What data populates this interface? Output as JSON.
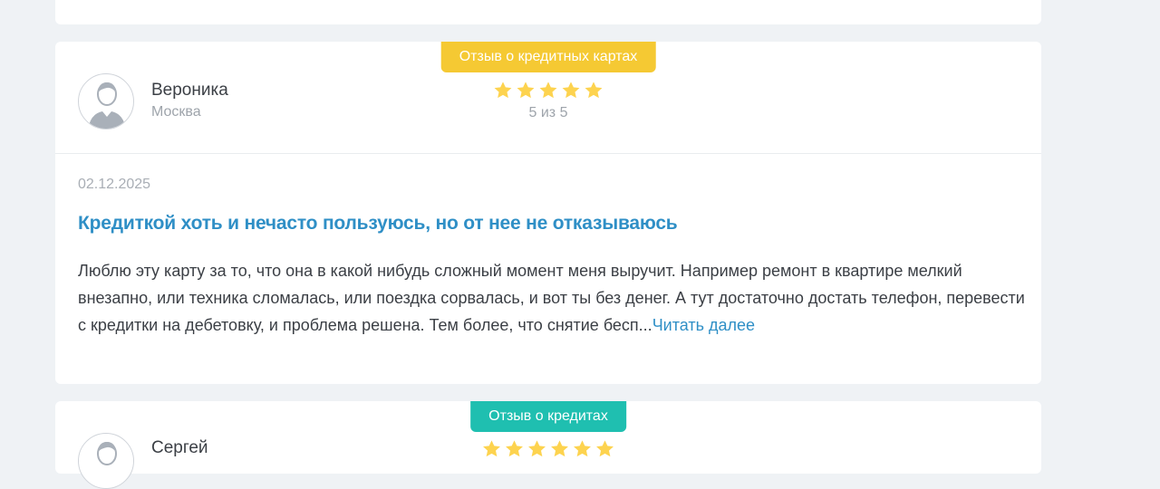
{
  "reviews": [
    {
      "badge": "Отзыв о кредитных картах",
      "author": "Вероника",
      "city": "Москва",
      "rating": 5,
      "rating_text": "5 из 5",
      "date": "02.12.2025",
      "title": "Кредиткой хоть и нечасто пользуюсь, но от нее не отказываюсь",
      "text": "Люблю эту карту за то, что она в какой нибудь сложный момент меня выручит. Например ремонт в квартире мелкий внезапно, или техника сломалась, или поездка сорвалась, и вот ты без денег. А тут достаточно достать телефон, перевести с кредитки на дебетовку, и проблема решена. Тем более, что снятие бесп...",
      "read_more": "Читать далее"
    },
    {
      "badge": "Отзыв о кредитах",
      "author": "Сергей",
      "rating": 5
    }
  ],
  "colors": {
    "page_bg": "#eff2f5",
    "badge_credit_cards": "#f5c933",
    "badge_credits": "#1fbfb0",
    "star": "#fdd34f",
    "link": "#2f8fc6"
  },
  "icons": {
    "avatar": "user-avatar-icon",
    "star": "star-icon"
  }
}
